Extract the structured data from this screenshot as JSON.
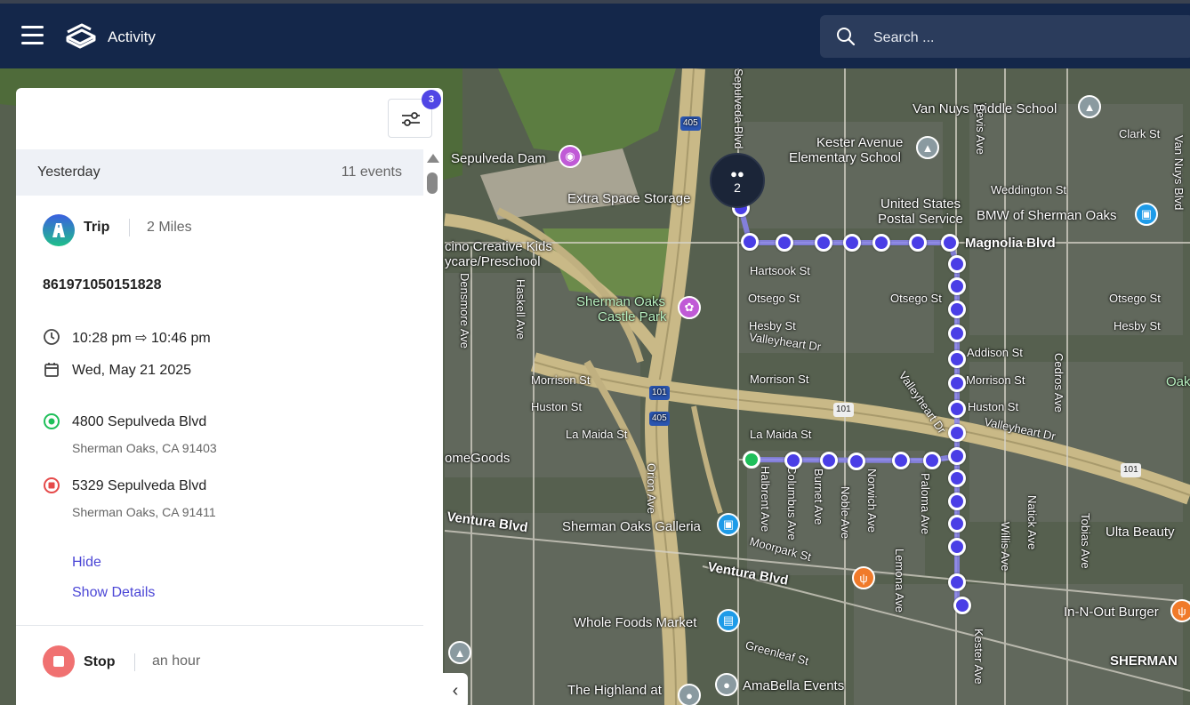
{
  "header": {
    "title": "Activity",
    "search_placeholder": "Search ...",
    "background": "#14274a"
  },
  "panel": {
    "filter_badge": "3",
    "section": {
      "day": "Yesterday",
      "count": "11 events"
    },
    "trip": {
      "type": "Trip",
      "distance": "2 Miles",
      "device_id": "861971050151828",
      "time_start": "10:28 pm",
      "time_end": "10:46 pm",
      "date": "Wed, May 21 2025",
      "start_address": "4800 Sepulveda Blvd",
      "start_city": "Sherman Oaks, CA 91403",
      "end_address": "5329 Sepulveda Blvd",
      "end_city": "Sherman Oaks, CA 91411",
      "hide_label": "Hide",
      "details_label": "Show Details"
    },
    "stop": {
      "type": "Stop",
      "duration": "an hour"
    }
  },
  "map": {
    "cluster_count": "2",
    "labels": {
      "sepulveda_dam": "Sepulveda Dam",
      "extra_space": "Extra Space Storage",
      "van_nuys_ms": "Van Nuys Middle School",
      "kester_school_1": "Kester Avenue",
      "kester_school_2": "Elementary School",
      "usps_1": "United States",
      "usps_2": "Postal Service",
      "bmw": "BMW of Sherman Oaks",
      "weddington": "Weddington St",
      "clark": "Clark St",
      "magnolia": "Magnolia Blvd",
      "hartsook": "Hartsook St",
      "otsego_1": "Otsego St",
      "otsego_2": "Otsego St",
      "otsego_3": "Otsego St",
      "hesby_1": "Hesby St",
      "hesby_2": "Hesby St",
      "valleyheart_1": "Valleyheart Dr",
      "valleyheart_2": "Valleyheart Dr",
      "valleyheart_3": "Valleyheart Dr",
      "addison": "Addison St",
      "morrison_1": "Morrison St",
      "morrison_2": "Morrison St",
      "morrison_3": "Morrison St",
      "huston_1": "Huston St",
      "huston_2": "Huston St",
      "la_maida_1": "La Maida St",
      "la_maida_2": "La Maida St",
      "creative_kids_1": "cino Creative Kids",
      "creative_kids_2": "ycare/Preschool",
      "castle_park_1": "Sherman Oaks",
      "castle_park_2": "Castle Park",
      "homegoods": "omeGoods",
      "ventura_1": "Ventura Blvd",
      "ventura_2": "Ventura Blvd",
      "galleria": "Sherman Oaks Galleria",
      "moorpark": "Moorpark St",
      "whole_foods": "Whole Foods Market",
      "in_n_out": "In-N-Out Burger",
      "ulta": "Ulta Beauty",
      "greenleaf": "Greenleaf St",
      "amabella": "AmaBella Events",
      "highland_1": "The Highland at",
      "sherman": "SHERMAN",
      "oak": "Oak",
      "denmore_1": "Densmore Ave",
      "haskell_1": "Haskell Ave",
      "orion": "Orion Ave",
      "halbrent": "Halbrent Ave",
      "columbus": "Columbus Ave",
      "burnet": "Burnet Ave",
      "noble_1": "Noble Ave",
      "norwich": "Norwich Ave",
      "lemona": "Lemona Ave",
      "paloma": "Paloma Ave",
      "willis": "Willis Ave",
      "natick": "Natick Ave",
      "tobias": "Tobias Ave",
      "cedros": "Cedros Ave",
      "kester": "Kester Ave",
      "bevis": "Bevis Ave",
      "van_nuys_blvd": "Van Nuys Blvd",
      "sepulveda_blvd": "Sepulveda Blvd",
      "hwy_405": "405",
      "hwy_101": "101"
    }
  },
  "colors": {
    "accent": "#4b46d6",
    "route": "#4a3ee6",
    "start": "#1fbf5a",
    "stop": "#f07171"
  }
}
